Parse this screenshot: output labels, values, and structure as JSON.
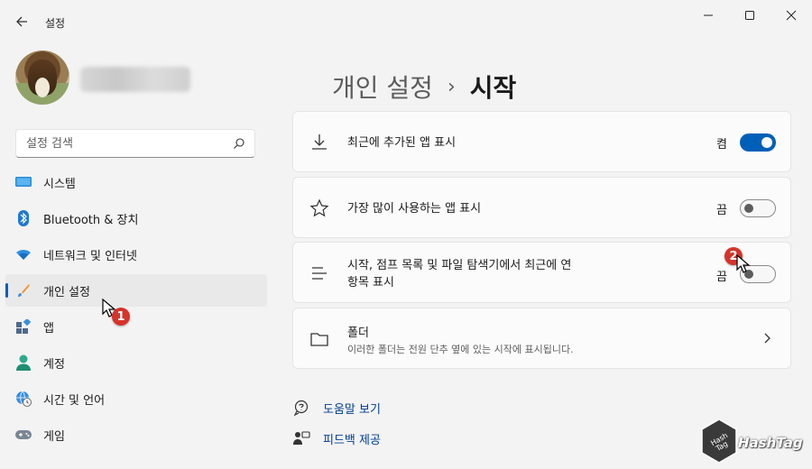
{
  "window": {
    "title": "설정",
    "controls": [
      "minimize",
      "maximize",
      "close"
    ]
  },
  "search": {
    "placeholder": "설정 검색"
  },
  "sidebar": {
    "items": [
      {
        "label": "시스템",
        "icon": "monitor-icon"
      },
      {
        "label": "Bluetooth & 장치",
        "icon": "bluetooth-icon"
      },
      {
        "label": "네트워크 및 인터넷",
        "icon": "wifi-icon"
      },
      {
        "label": "개인 설정",
        "icon": "brush-icon",
        "selected": true
      },
      {
        "label": "앱",
        "icon": "apps-icon"
      },
      {
        "label": "계정",
        "icon": "person-icon"
      },
      {
        "label": "시간 및 언어",
        "icon": "globe-clock-icon"
      },
      {
        "label": "게임",
        "icon": "gamepad-icon"
      }
    ]
  },
  "breadcrumb": {
    "parent": "개인 설정",
    "separator": "›",
    "current": "시작"
  },
  "settings": [
    {
      "label": "최근에 추가된 앱 표시",
      "state": "켬",
      "on": true,
      "icon": "download-icon"
    },
    {
      "label": "가장 많이 사용하는 앱 표시",
      "state": "끔",
      "on": false,
      "icon": "star-icon"
    },
    {
      "label_line1": "시작, 점프 목록 및 파일 탐색기에서 최근에 연",
      "label_line2": "항목 표시",
      "state": "끔",
      "on": false,
      "icon": "list-icon"
    },
    {
      "label": "폴더",
      "sub": "이러한 폴더는 전원 단추 옆에 있는 시작에 표시됩니다.",
      "icon": "folder-icon"
    }
  ],
  "links": [
    {
      "label": "도움말 보기",
      "icon": "help-icon"
    },
    {
      "label": "피드백 제공",
      "icon": "feedback-icon"
    }
  ],
  "annotations": [
    {
      "number": "1"
    },
    {
      "number": "2"
    }
  ],
  "watermark": {
    "text": "HashTag"
  },
  "colors": {
    "accent": "#005fb8",
    "background": "#f3f3f3",
    "card": "#fbfbfb",
    "badge": "#d6332a"
  }
}
